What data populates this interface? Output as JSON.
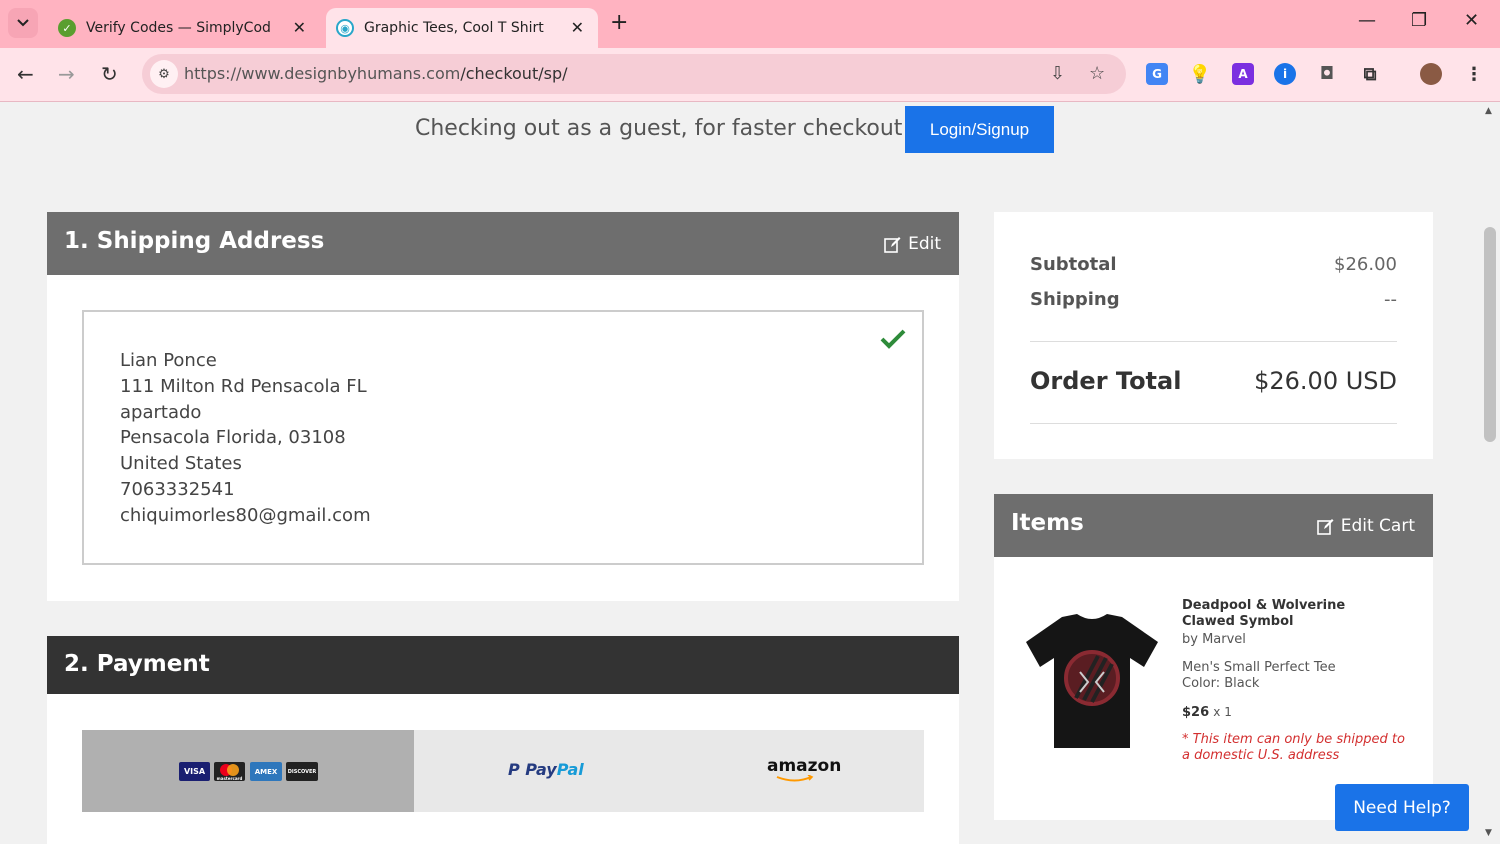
{
  "browser": {
    "tabs": [
      {
        "title": "Verify Codes — SimplyCodes"
      },
      {
        "title": "Graphic Tees, Cool T Shirt Designs"
      }
    ],
    "url_domain": "https://www.designbyhumans.com",
    "url_path": "/checkout/sp/",
    "new_tab_symbol": "+",
    "close_symbol": "✕"
  },
  "header": {
    "guest_text": "Checking out as a guest, for faster checkout",
    "login_label": "Login/Signup"
  },
  "shipping": {
    "title": "1. Shipping Address",
    "edit_label": "Edit",
    "lines": {
      "name": "Lian Ponce",
      "street": "111 Milton Rd Pensacola FL",
      "apt": "apartado",
      "city": "Pensacola Florida, 03108",
      "country": "United States",
      "phone": "7063332541",
      "email": "chiquimorles80@gmail.com"
    }
  },
  "payment": {
    "title": "2. Payment",
    "cards": {
      "visa": "VISA",
      "mastercard": "mastercard",
      "amex": "AMEX",
      "discover": "DISCOVER"
    },
    "paypal_p1": "Pay",
    "paypal_p2": "Pal",
    "amazon": "amazon"
  },
  "summary": {
    "subtotal_label": "Subtotal",
    "subtotal_value": "$26.00",
    "shipping_label": "Shipping",
    "shipping_value": "--",
    "total_label": "Order Total",
    "total_value": "$26.00 USD"
  },
  "items": {
    "title": "Items",
    "edit_label": "Edit Cart",
    "product": {
      "name": "Deadpool & Wolverine Clawed Symbol",
      "artist": "by Marvel",
      "style": "Men's Small Perfect Tee",
      "color": "Color: Black",
      "price": "$26",
      "qty": "x 1",
      "warning": "* This item can only be shipped to a domestic U.S. address"
    }
  },
  "help_label": "Need Help?",
  "colors": {
    "accent": "#1a73e8",
    "panel_header_gray": "#6e6e6e",
    "panel_header_dark": "#333333",
    "check_green": "#2e8b3a",
    "warning_red": "#d32f2f",
    "tab_bar": "#ffb3c1"
  }
}
